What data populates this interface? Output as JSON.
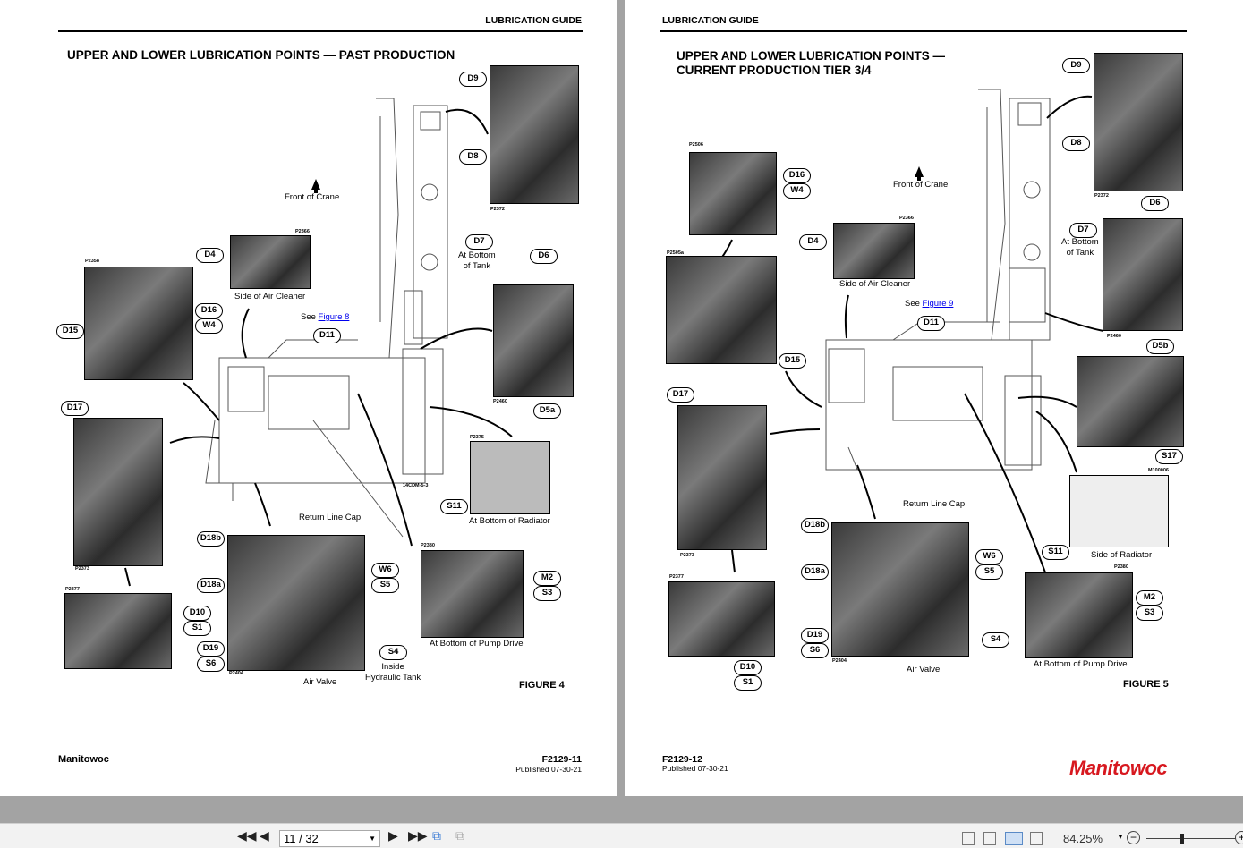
{
  "left_page": {
    "header": "LUBRICATION GUIDE",
    "title": "UPPER AND LOWER LUBRICATION POINTS — PAST PRODUCTION",
    "front_of_crane": "Front of Crane",
    "see": "See",
    "figure_link": "Figure 8",
    "captions": {
      "air_cleaner": "Side of Air Cleaner",
      "bottom_tank_1": "At Bottom",
      "bottom_tank_2": "of Tank",
      "bottom_radiator": "At Bottom of Radiator",
      "return_line_cap": "Return Line Cap",
      "inside_tank_1": "Inside",
      "inside_tank_2": "Hydraulic Tank",
      "air_valve": "Air Valve",
      "pump_drive": "At Bottom of Pump Drive",
      "drawing_id": "14CDM-5-3"
    },
    "photo_ids": {
      "p2372": "P2372",
      "p2366": "P2366",
      "p2358": "P2358",
      "p2460": "P2460",
      "p2373": "P2373",
      "p2375": "P2375",
      "p2404": "P2404",
      "p2377": "P2377",
      "p2380": "P2380"
    },
    "callouts": {
      "d9": "D9",
      "d8": "D8",
      "d4": "D4",
      "d16": "D16",
      "w4": "W4",
      "d15": "D15",
      "d11": "D11",
      "d7": "D7",
      "d6": "D6",
      "d5a": "D5a",
      "d17": "D17",
      "s11": "S11",
      "d18b": "D18b",
      "w6": "W6",
      "s5": "S5",
      "d18a": "D18a",
      "d19": "D19",
      "s6": "S6",
      "s4": "S4",
      "d10": "D10",
      "s1": "S1",
      "m2": "M2",
      "s3": "S3"
    },
    "figure": "FIGURE 4",
    "footer": {
      "brand": "Manitowoc",
      "doc": "F2129-11",
      "published": "Published 07-30-21"
    }
  },
  "right_page": {
    "header": "LUBRICATION GUIDE",
    "title_1": "UPPER AND LOWER LUBRICATION POINTS —",
    "title_2": "CURRENT PRODUCTION TIER 3/4",
    "front_of_crane": "Front of Crane",
    "see": "See",
    "figure_link": "Figure 9",
    "captions": {
      "air_cleaner": "Side of Air Cleaner",
      "bottom_tank_1": "At Bottom",
      "bottom_tank_2": "of Tank",
      "side_radiator": "Side of Radiator",
      "return_line_cap": "Return Line Cap",
      "air_valve": "Air Valve",
      "pump_drive": "At Bottom of Pump Drive"
    },
    "photo_ids": {
      "p2372": "P2372",
      "p2506": "P2506",
      "p2366": "P2366",
      "p2505a": "P2505a",
      "p2460": "P2460",
      "m100006": "M100006",
      "p2380": "P2380",
      "p2373": "P2373",
      "p2377": "P2377",
      "p2404": "P2404"
    },
    "callouts": {
      "d9": "D9",
      "d8": "D8",
      "d16": "D16",
      "w4": "W4",
      "d4": "D4",
      "d15": "D15",
      "d11": "D11",
      "d7": "D7",
      "d6": "D6",
      "d5b": "D5b",
      "s17": "S17",
      "s11": "S11",
      "m2": "M2",
      "s3": "S3",
      "d17": "D17",
      "d10": "D10",
      "s1": "S1",
      "d18b": "D18b",
      "w6": "W6",
      "s5": "S5",
      "d18a": "D18a",
      "d19": "D19",
      "s6": "S6",
      "s4": "S4"
    },
    "figure": "FIGURE 5",
    "footer": {
      "doc": "F2129-12",
      "published": "Published 07-30-21",
      "logo": "Manitowoc"
    }
  },
  "toolbar": {
    "page_value": "11 / 32",
    "zoom": "84.25%",
    "zoom_fraction": 0.4
  },
  "colors": {
    "brand_red": "#d7181f",
    "link": "#0000ee"
  }
}
